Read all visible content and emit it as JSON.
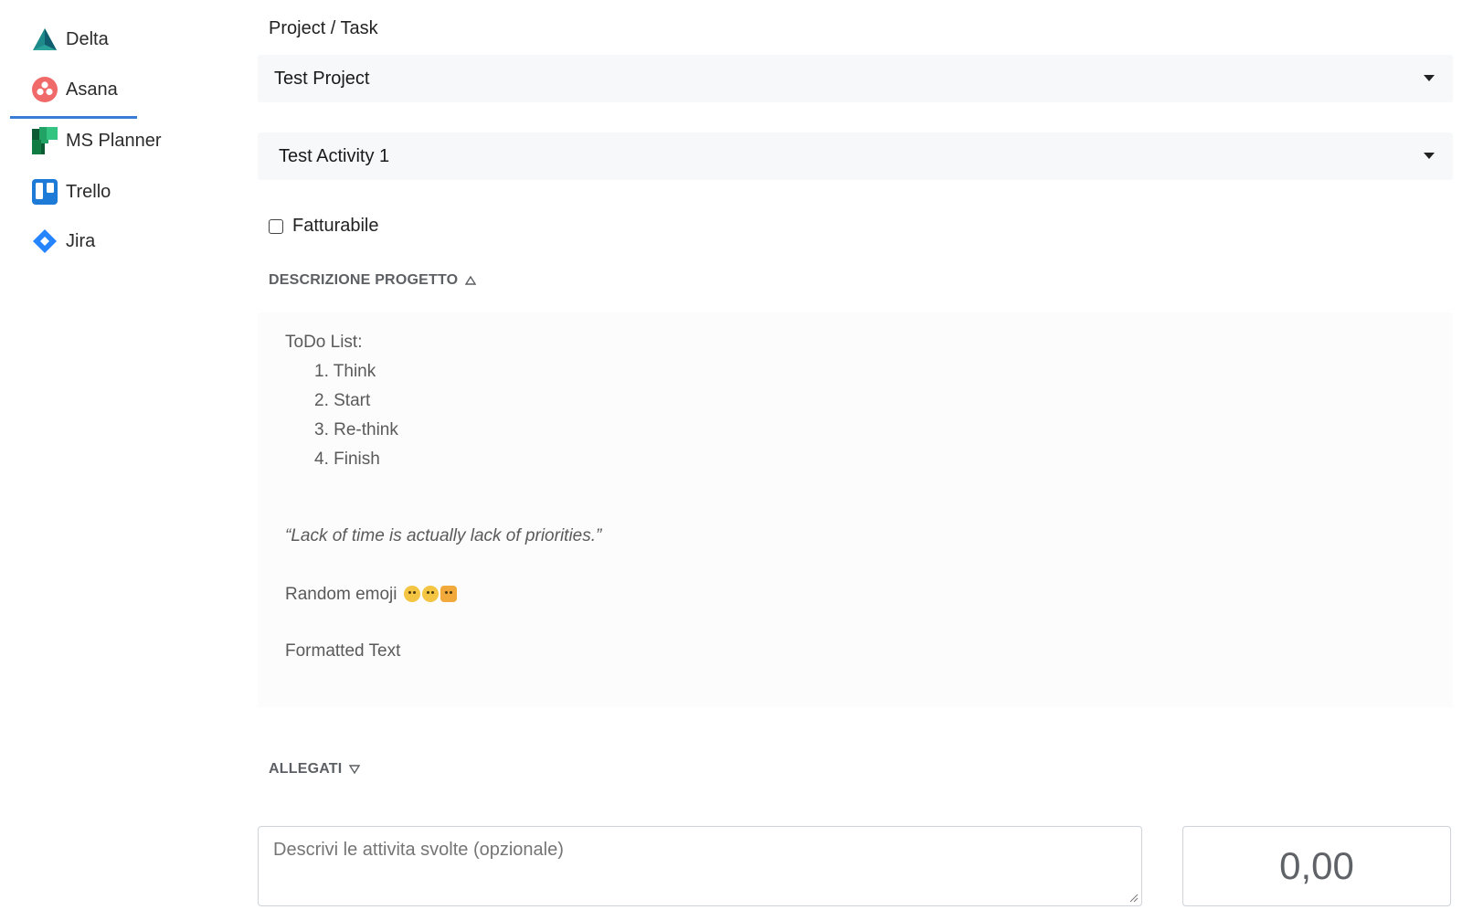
{
  "sidebar": {
    "items": [
      {
        "label": "Delta",
        "icon": "delta-icon"
      },
      {
        "label": "Asana",
        "icon": "asana-icon",
        "active": true
      },
      {
        "label": "MS Planner",
        "icon": "ms-planner-icon"
      },
      {
        "label": "Trello",
        "icon": "trello-icon"
      },
      {
        "label": "Jira",
        "icon": "jira-icon"
      }
    ],
    "active_color": "#3a7bd5"
  },
  "form": {
    "project_task_label": "Project / Task",
    "project_select": {
      "value": "Test Project"
    },
    "activity_select": {
      "value": "Test Activity 1"
    },
    "billable_label": "Fatturabile",
    "billable_checked": false,
    "description_header": "DESCRIZIONE PROGETTO",
    "description": {
      "todo_title": "ToDo List:",
      "todo_items": [
        "1. Think",
        "2. Start",
        "3. Re-think",
        "4. Finish"
      ],
      "quote": "“Lack of time is actually lack of priorities.”",
      "emoji_line": "Random emoji",
      "formatted_text": "Formatted Text"
    },
    "attachments_header": "ALLEGATI",
    "notes_placeholder": "Descrivi le attivita svolte (opzionale)",
    "hours_value": "0,00"
  }
}
